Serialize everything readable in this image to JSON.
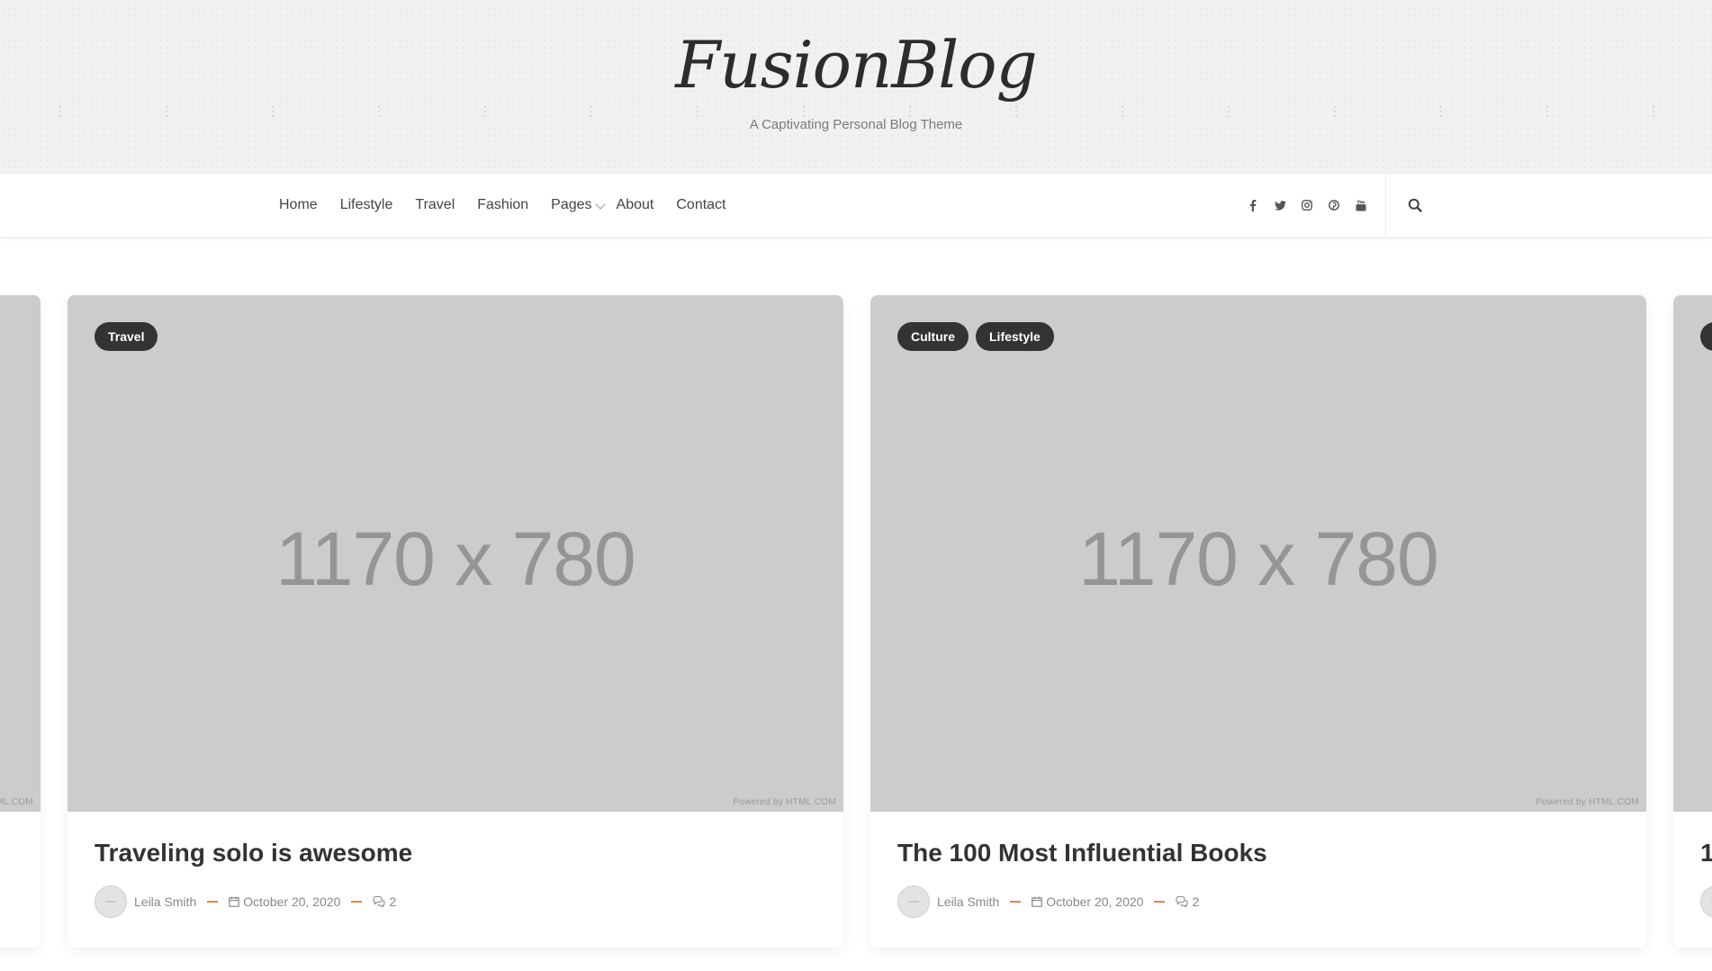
{
  "header": {
    "logo": "FusionBlog",
    "tagline": "A Captivating Personal Blog Theme"
  },
  "nav": {
    "items": [
      "Home",
      "Lifestyle",
      "Travel",
      "Fashion",
      "Pages",
      "About",
      "Contact"
    ],
    "social_icons": [
      "facebook-icon",
      "twitter-icon",
      "instagram-icon",
      "pinterest-icon",
      "youtube-icon"
    ],
    "search_icon": "search-icon"
  },
  "cards": [
    {
      "image_text": "1170 x 780",
      "powered": "Powered by HTML.COM",
      "tags": [
        "Travel"
      ],
      "title": "Traveling solo is awesome",
      "author": "Leila Smith",
      "date": "October 20, 2020",
      "comments": "2"
    },
    {
      "image_text": "1170 x 780",
      "powered": "Powered by HTML.COM",
      "tags": [
        "Culture",
        "Lifestyle"
      ],
      "title": "The 100 Most Influential Books",
      "author": "Leila Smith",
      "date": "October 20, 2020",
      "comments": "2"
    }
  ],
  "edge_cards": {
    "left_powered_fragment": "ML.COM",
    "right_title_fragment": "1"
  },
  "colors": {
    "accent": "#e8843e",
    "tag_bg": "#333333",
    "placeholder_bg": "#cccccc"
  }
}
